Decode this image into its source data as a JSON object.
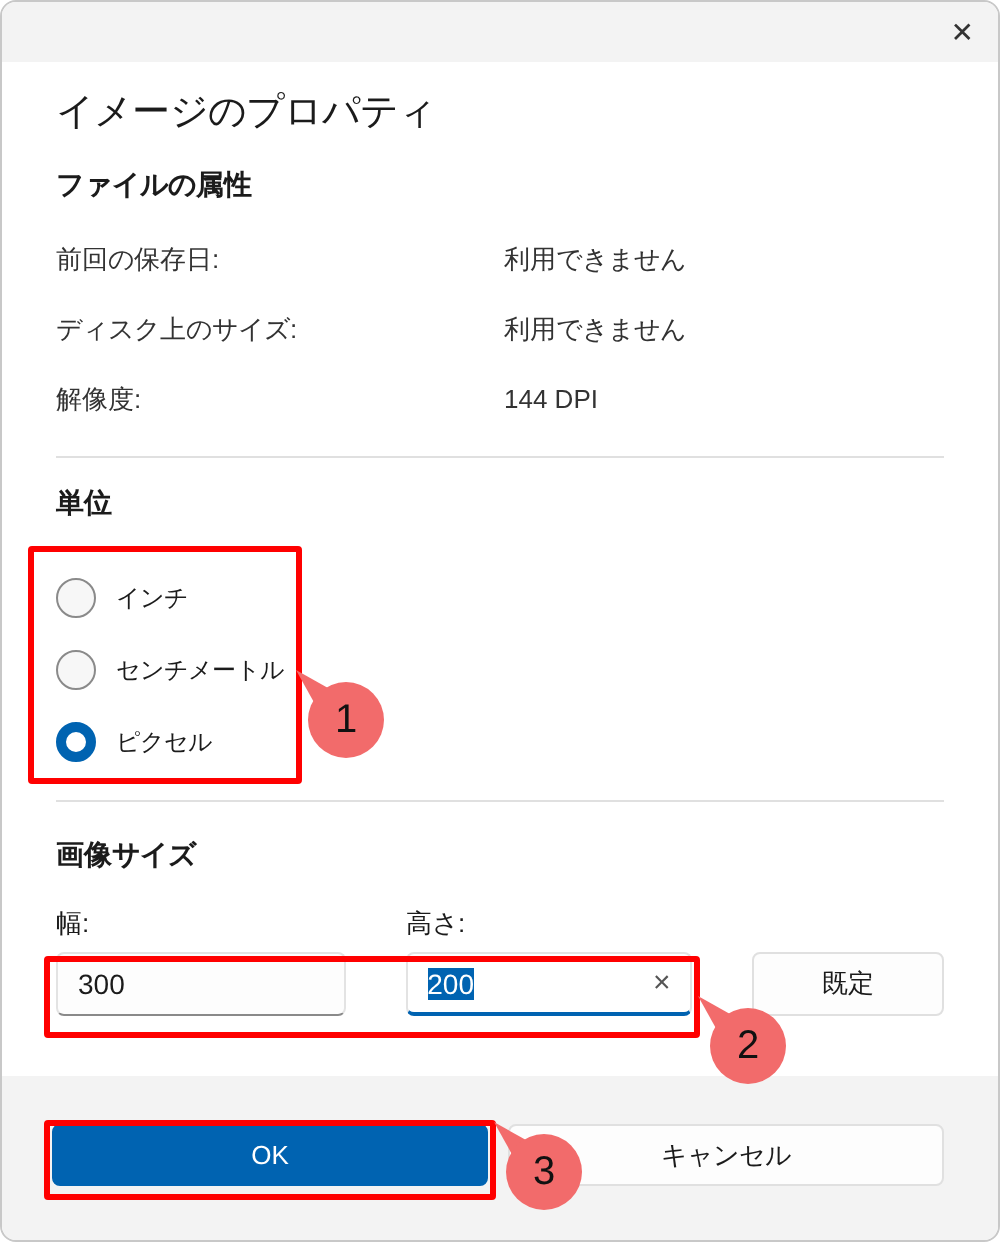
{
  "window": {
    "close_glyph": "✕"
  },
  "title": "イメージのプロパティ",
  "file_attributes": {
    "heading": "ファイルの属性",
    "rows": [
      {
        "label": "前回の保存日:",
        "value": "利用できません"
      },
      {
        "label": "ディスク上のサイズ:",
        "value": "利用できません"
      },
      {
        "label": "解像度:",
        "value": "144 DPI"
      }
    ]
  },
  "units": {
    "heading": "単位",
    "options": [
      {
        "label": "インチ",
        "selected": false
      },
      {
        "label": "センチメートル",
        "selected": false
      },
      {
        "label": "ピクセル",
        "selected": true
      }
    ]
  },
  "image_size": {
    "heading": "画像サイズ",
    "width": {
      "label": "幅:",
      "value": "300",
      "focused": false
    },
    "height": {
      "label": "高さ:",
      "value": "200",
      "focused": true,
      "clear_glyph": "×"
    },
    "default_button": "既定"
  },
  "buttons": [
    {
      "label": "OK",
      "kind": "primary"
    },
    {
      "label": "キャンセル",
      "kind": "secondary"
    }
  ],
  "callouts": [
    {
      "label": "1"
    },
    {
      "label": "2"
    },
    {
      "label": "3"
    }
  ]
}
